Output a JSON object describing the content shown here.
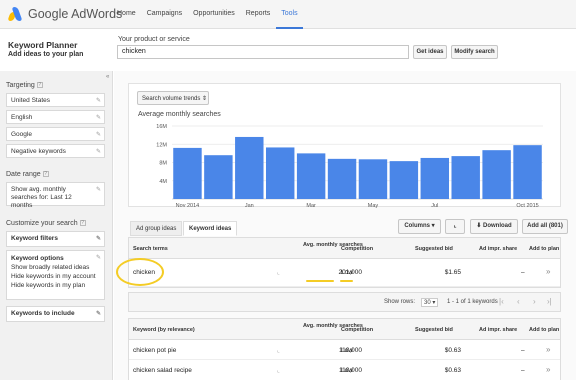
{
  "app": {
    "logo_text": "Google AdWords"
  },
  "nav": [
    {
      "label": "Home"
    },
    {
      "label": "Campaigns"
    },
    {
      "label": "Opportunities"
    },
    {
      "label": "Reports"
    },
    {
      "label": "Tools",
      "active": true
    }
  ],
  "header": {
    "title": "Keyword Planner",
    "subtitle": "Add ideas to your plan",
    "product_label": "Your product or service",
    "product_value": "chicken",
    "get_ideas": "Get ideas",
    "modify_search": "Modify search"
  },
  "sidebar": {
    "collapse": "«",
    "targeting_label": "Targeting",
    "targeting": [
      "United States",
      "English",
      "Google",
      "Negative keywords"
    ],
    "date_range_label": "Date range",
    "date_range": "Show avg. monthly searches for: Last 12 months",
    "customize_label": "Customize your search",
    "keyword_filters": "Keyword filters",
    "keyword_options_title": "Keyword options",
    "keyword_options": [
      "Show broadly related ideas",
      "Hide keywords in my account",
      "Hide keywords in my plan"
    ],
    "keywords_to_include": "Keywords to include"
  },
  "chart": {
    "selector": "Search volume trends",
    "title": "Average monthly searches"
  },
  "chart_data": {
    "type": "bar",
    "title": "Average monthly searches",
    "categories": [
      "Nov 2014",
      "Dec 2014",
      "Jan 2015",
      "Feb 2015",
      "Mar 2015",
      "Apr 2015",
      "May 2015",
      "Jun 2015",
      "Jul 2015",
      "Aug 2015",
      "Sep 2015",
      "Oct 2015"
    ],
    "x_tick_labels": [
      "Nov 2014",
      "Jan",
      "Mar",
      "May",
      "Jul",
      "Oct 2015"
    ],
    "values": [
      11200000,
      9600000,
      13600000,
      11300000,
      10000000,
      8800000,
      8700000,
      8300000,
      9000000,
      9400000,
      10700000,
      11800000
    ],
    "y_ticks": [
      "4M",
      "8M",
      "12M",
      "16M"
    ],
    "ylim": [
      0,
      16000000
    ],
    "bar_color": "#4a86e8",
    "grid": true
  },
  "tabs": {
    "ad_group": "Ad group ideas",
    "keyword": "Keyword ideas",
    "columns": "Columns",
    "download": "Download",
    "add_all": "Add all (801)"
  },
  "search_table": {
    "headers": [
      "Search terms",
      "Avg. monthly searches",
      "Competition",
      "Suggested bid",
      "Ad impr. share",
      "Add to plan"
    ],
    "row": {
      "term": "chicken",
      "searches": "201,000",
      "competition": "Low",
      "bid": "$1.65",
      "share": "–"
    }
  },
  "pager": {
    "show_rows_label": "Show rows:",
    "rows": "30",
    "range": "1 - 1 of 1 keywords"
  },
  "keyword_table": {
    "headers": [
      "Keyword (by relevance)",
      "Avg. monthly searches",
      "Competition",
      "Suggested bid",
      "Ad impr. share",
      "Add to plan"
    ],
    "rows": [
      {
        "keyword": "chicken pot pie",
        "searches": "110,000",
        "competition": "Low",
        "bid": "$0.63",
        "share": "–"
      },
      {
        "keyword": "chicken salad recipe",
        "searches": "110,000",
        "competition": "Low",
        "bid": "$0.63",
        "share": "–"
      }
    ]
  },
  "colors": {
    "accent": "#3c78d8",
    "bar": "#4a86e8",
    "highlight": "#f4cc25"
  }
}
